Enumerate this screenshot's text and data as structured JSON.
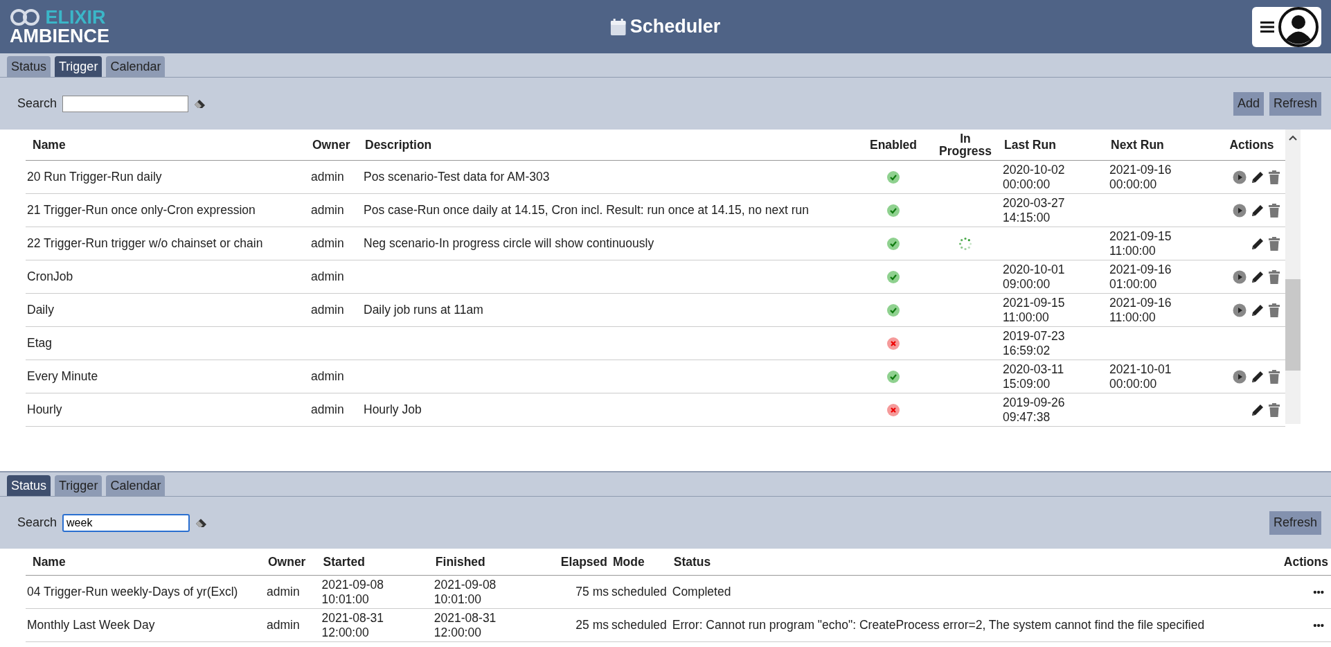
{
  "header": {
    "logo": {
      "top": "ELIXIR",
      "bottom": "AMBIENCE"
    },
    "title": "Scheduler"
  },
  "top_panel": {
    "tabs": [
      {
        "label": "Status",
        "selected": false
      },
      {
        "label": "Trigger",
        "selected": true
      },
      {
        "label": "Calendar",
        "selected": false
      }
    ],
    "search": {
      "label": "Search"
    },
    "buttons": [
      "Add",
      "Refresh"
    ],
    "columns": [
      "Name",
      "Owner",
      "Description",
      "Enabled",
      "In Progress",
      "Last Run",
      "Next Run",
      "Actions"
    ],
    "rows": [
      {
        "name": "20 Run Trigger-Run daily",
        "owner": "admin",
        "description": "Pos scenario-Test data for AM-303",
        "enabled": true,
        "in_progress": false,
        "last_run": [
          "2020-10-02",
          "00:00:00"
        ],
        "next_run": [
          "2021-09-16",
          "00:00:00"
        ],
        "actions": [
          {
            "kind": "run"
          },
          {
            "kind": "edit"
          },
          {
            "kind": "delete"
          }
        ]
      },
      {
        "name": "21 Trigger-Run once only-Cron expression",
        "owner": "admin",
        "description": "Pos case-Run once daily at 14.15, Cron incl. Result: run once at 14.15, no next run",
        "enabled": true,
        "in_progress": false,
        "last_run": [
          "2020-03-27",
          "14:15:00"
        ],
        "actions": [
          {
            "kind": "run"
          },
          {
            "kind": "edit"
          },
          {
            "kind": "delete"
          }
        ]
      },
      {
        "name": "22 Trigger-Run trigger w/o chainset or chain",
        "owner": "admin",
        "description": "Neg scenario-In progress circle will show continuously",
        "enabled": true,
        "in_progress": true,
        "next_run": [
          "2021-09-15",
          "11:00:00"
        ],
        "actions": [
          {
            "kind": "edit"
          },
          {
            "kind": "delete"
          }
        ]
      },
      {
        "name": "CronJob",
        "owner": "admin",
        "enabled": true,
        "in_progress": false,
        "last_run": [
          "2020-10-01",
          "09:00:00"
        ],
        "next_run": [
          "2021-09-16",
          "01:00:00"
        ],
        "actions": [
          {
            "kind": "run"
          },
          {
            "kind": "edit"
          },
          {
            "kind": "delete"
          }
        ]
      },
      {
        "name": "Daily",
        "owner": "admin",
        "description": "Daily job runs at 11am",
        "enabled": true,
        "in_progress": false,
        "last_run": [
          "2021-09-15",
          "11:00:00"
        ],
        "next_run": [
          "2021-09-16",
          "11:00:00"
        ],
        "actions": [
          {
            "kind": "run"
          },
          {
            "kind": "edit"
          },
          {
            "kind": "delete"
          }
        ]
      },
      {
        "name": "Etag",
        "enabled": false,
        "in_progress": false,
        "last_run": [
          "2019-07-23",
          "16:59:02"
        ]
      },
      {
        "name": "Every Minute",
        "owner": "admin",
        "enabled": true,
        "in_progress": false,
        "last_run": [
          "2020-03-11",
          "15:09:00"
        ],
        "next_run": [
          "2021-10-01",
          "00:00:00"
        ],
        "actions": [
          {
            "kind": "run"
          },
          {
            "kind": "edit"
          },
          {
            "kind": "delete"
          }
        ]
      },
      {
        "name": "Hourly",
        "owner": "admin",
        "description": "Hourly Job",
        "enabled": false,
        "in_progress": false,
        "last_run": [
          "2019-09-26",
          "09:47:38"
        ],
        "actions": [
          {
            "kind": "edit"
          },
          {
            "kind": "delete"
          }
        ]
      }
    ]
  },
  "bottom_panel": {
    "tabs": [
      {
        "label": "Status",
        "selected": true
      },
      {
        "label": "Trigger",
        "selected": false
      },
      {
        "label": "Calendar",
        "selected": false
      }
    ],
    "search": {
      "label": "Search",
      "value": "week"
    },
    "buttons": [
      "Refresh"
    ],
    "columns": [
      "Name",
      "Owner",
      "Started",
      "Finished",
      "Elapsed",
      "Mode",
      "Status",
      "Actions"
    ],
    "rows": [
      {
        "name": "04 Trigger-Run weekly-Days of yr(Excl)",
        "owner": "admin",
        "started": [
          "2021-09-08",
          "10:01:00"
        ],
        "finished": [
          "2021-09-08",
          "10:01:00"
        ],
        "elapsed": "75 ms",
        "mode": "scheduled",
        "status": "Completed",
        "menu": "•••"
      },
      {
        "name": "Monthly Last Week Day",
        "owner": "admin",
        "started": [
          "2021-08-31",
          "12:00:00"
        ],
        "finished": [
          "2021-08-31",
          "12:00:00"
        ],
        "elapsed": "25 ms",
        "mode": "scheduled",
        "status": "Error: Cannot run program \"echo\": CreateProcess error=2, The system cannot find the file specified",
        "menu": "•••"
      }
    ]
  }
}
